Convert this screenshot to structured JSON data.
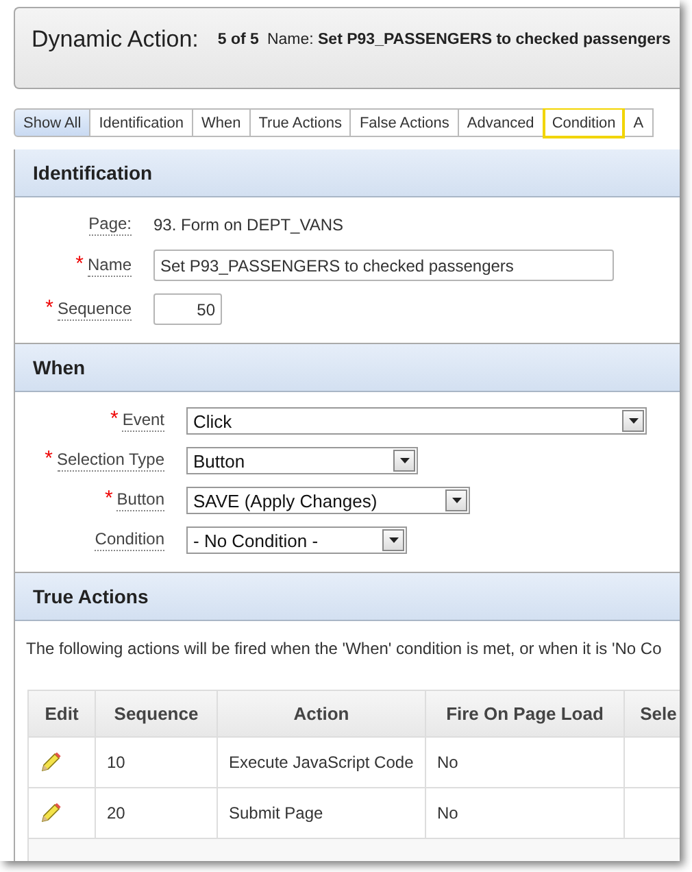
{
  "header": {
    "title": "Dynamic Action:",
    "position": "5 of 5",
    "name_label": "Name:",
    "name_value": "Set P93_PASSENGERS to checked passengers"
  },
  "tabs": [
    {
      "label": "Show All",
      "selected": true,
      "focused": false
    },
    {
      "label": "Identification",
      "selected": false,
      "focused": false
    },
    {
      "label": "When",
      "selected": false,
      "focused": false
    },
    {
      "label": "True Actions",
      "selected": false,
      "focused": false
    },
    {
      "label": "False Actions",
      "selected": false,
      "focused": false
    },
    {
      "label": "Advanced",
      "selected": false,
      "focused": false
    },
    {
      "label": "Condition",
      "selected": false,
      "focused": true
    },
    {
      "label": "A",
      "selected": false,
      "focused": false
    }
  ],
  "sections": [
    {
      "kind": "form",
      "title": "Identification",
      "fields": [
        {
          "kind": "static",
          "label": "Page:",
          "value": "93. Form on DEPT_VANS"
        },
        {
          "kind": "text",
          "label": "Name",
          "required_mark": "*",
          "value": "Set P93_PASSENGERS to checked passengers"
        },
        {
          "kind": "number",
          "label": "Sequence",
          "required_mark": "*",
          "value": "50"
        }
      ]
    },
    {
      "kind": "form",
      "title": "When",
      "fields": [
        {
          "kind": "select",
          "label": "Event",
          "required_mark": "*",
          "value": "Click"
        },
        {
          "kind": "select",
          "label": "Selection Type",
          "required_mark": "*",
          "value": "Button"
        },
        {
          "kind": "select",
          "label": "Button",
          "required_mark": "*",
          "value": "SAVE (Apply Changes)"
        },
        {
          "kind": "select",
          "label": "Condition",
          "value": "- No Condition -"
        }
      ]
    },
    {
      "kind": "table",
      "title": "True Actions",
      "description": "The following actions will be fired when the 'When' condition is met, or when it is 'No Co",
      "columns": [
        "Edit",
        "Sequence",
        "Action",
        "Fire On Page Load",
        "Sele"
      ],
      "rows": [
        {
          "sequence": "10",
          "action": "Execute JavaScript Code",
          "fire_on_page_load": "No"
        },
        {
          "sequence": "20",
          "action": "Submit Page",
          "fire_on_page_load": "No"
        }
      ]
    }
  ]
}
